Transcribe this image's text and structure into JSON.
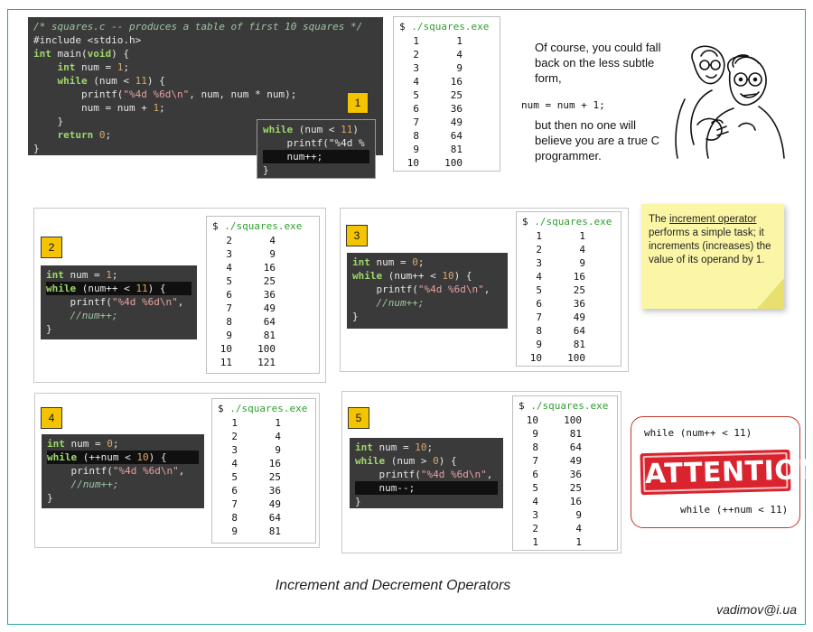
{
  "main_code": [
    "/* squares.c -- produces a table of first 10 squares */",
    "#include <stdio.h>",
    "int main(void) {",
    "    int num = 1;",
    "    while (num < 11) {",
    "        printf(\"%4d %6d\\n\", num, num * num);",
    "        num = num + 1;",
    "    }",
    "    return 0;",
    "}"
  ],
  "snippet1": [
    "while (num < 11)",
    "    printf(\"%4d %",
    "    num++;",
    "}"
  ],
  "terminal_prompt": "$ ",
  "terminal_cmd": "./squares.exe",
  "out1": [
    [
      "1",
      "1"
    ],
    [
      "2",
      "4"
    ],
    [
      "3",
      "9"
    ],
    [
      "4",
      "16"
    ],
    [
      "5",
      "25"
    ],
    [
      "6",
      "36"
    ],
    [
      "7",
      "49"
    ],
    [
      "8",
      "64"
    ],
    [
      "9",
      "81"
    ],
    [
      "10",
      "100"
    ]
  ],
  "aside": {
    "line1": "Of course, you could fall",
    "line2": "back on the less subtle",
    "line3": "form,",
    "code": "num = num + 1;",
    "line4": "but then no one will",
    "line5": "believe you are a true C",
    "line6": "programmer."
  },
  "badges": {
    "b1": "1",
    "b2": "2",
    "b3": "3",
    "b4": "4",
    "b5": "5"
  },
  "code2": [
    "int num = 1;",
    "while (num++ < 11) {",
    "    printf(\"%4d %6d\\n\",",
    "    //num++;",
    "}"
  ],
  "out2": [
    [
      "2",
      "4"
    ],
    [
      "3",
      "9"
    ],
    [
      "4",
      "16"
    ],
    [
      "5",
      "25"
    ],
    [
      "6",
      "36"
    ],
    [
      "7",
      "49"
    ],
    [
      "8",
      "64"
    ],
    [
      "9",
      "81"
    ],
    [
      "10",
      "100"
    ],
    [
      "11",
      "121"
    ]
  ],
  "code3": [
    "int num = 0;",
    "while (num++ < 10) {",
    "    printf(\"%4d %6d\\n\",",
    "    //num++;",
    "}"
  ],
  "out3": [
    [
      "1",
      "1"
    ],
    [
      "2",
      "4"
    ],
    [
      "3",
      "9"
    ],
    [
      "4",
      "16"
    ],
    [
      "5",
      "25"
    ],
    [
      "6",
      "36"
    ],
    [
      "7",
      "49"
    ],
    [
      "8",
      "64"
    ],
    [
      "9",
      "81"
    ],
    [
      "10",
      "100"
    ]
  ],
  "code4": [
    "int num = 0;",
    "while (++num < 10) {",
    "    printf(\"%4d %6d\\n\",",
    "    //num++;",
    "}"
  ],
  "out4": [
    [
      "1",
      "1"
    ],
    [
      "2",
      "4"
    ],
    [
      "3",
      "9"
    ],
    [
      "4",
      "16"
    ],
    [
      "5",
      "25"
    ],
    [
      "6",
      "36"
    ],
    [
      "7",
      "49"
    ],
    [
      "8",
      "64"
    ],
    [
      "9",
      "81"
    ]
  ],
  "code5": [
    "int num = 10;",
    "while (num > 0) {",
    "    printf(\"%4d %6d\\n\",",
    "    num--;",
    "}"
  ],
  "out5": [
    [
      "10",
      "100"
    ],
    [
      "9",
      "81"
    ],
    [
      "8",
      "64"
    ],
    [
      "7",
      "49"
    ],
    [
      "6",
      "36"
    ],
    [
      "5",
      "25"
    ],
    [
      "4",
      "16"
    ],
    [
      "3",
      "9"
    ],
    [
      "2",
      "4"
    ],
    [
      "1",
      "1"
    ]
  ],
  "sticky": {
    "pre": "The ",
    "term": "increment operator",
    "rest": " performs a simple task; it increments (increases) the value of its operand by 1."
  },
  "attention": {
    "top": "while (num++ < 11)",
    "stamp": "ATTENTION",
    "bottom": "while (++num < 11)"
  },
  "caption": "Increment and Decrement Operators",
  "email": "vadimov@i.ua"
}
